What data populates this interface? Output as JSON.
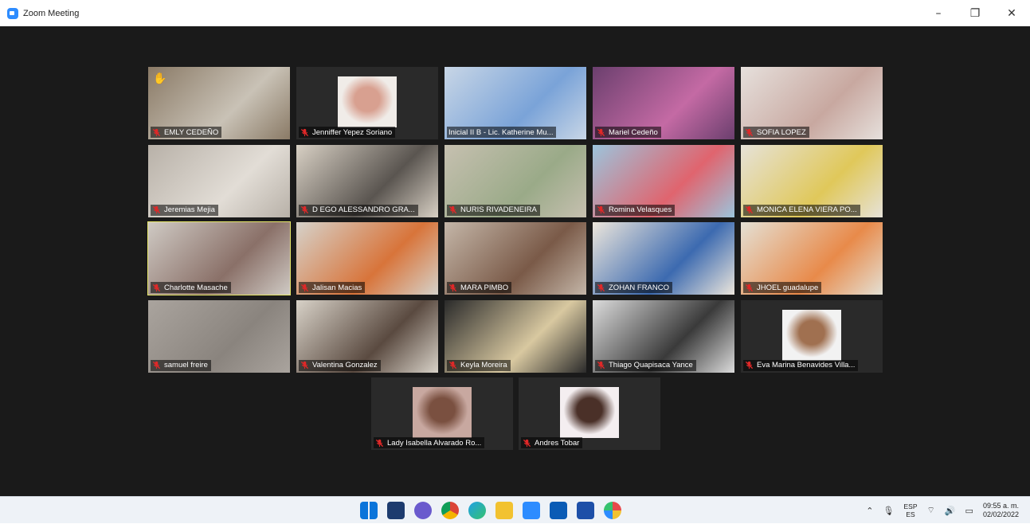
{
  "window": {
    "title": "Zoom Meeting",
    "minimize": "–",
    "restore": "❐",
    "close": "✕"
  },
  "participants": [
    {
      "name": "EMLY CEDEÑO",
      "muted": true,
      "hand_raised": true
    },
    {
      "name": "Jenniffer Yepez Soriano",
      "muted": true,
      "photo": true
    },
    {
      "name": "Inicial II B - Lic. Katherine Mu...",
      "muted": false
    },
    {
      "name": "Mariel Cedeño",
      "muted": true
    },
    {
      "name": "SOFIA LOPEZ",
      "muted": true
    },
    {
      "name": "Jeremias Mejia",
      "muted": true
    },
    {
      "name": "D EGO ALESSANDRO GRA...",
      "muted": true
    },
    {
      "name": "NURIS RIVADENEIRA",
      "muted": true
    },
    {
      "name": "Romina Velasques",
      "muted": true
    },
    {
      "name": "MONICA ELENA VIERA PO...",
      "muted": true
    },
    {
      "name": "Charlotte Masache",
      "muted": true,
      "active_speaker": true
    },
    {
      "name": "Jalisan Macias",
      "muted": true
    },
    {
      "name": "MARA PIMBO",
      "muted": true
    },
    {
      "name": "ZOHAN FRANCO",
      "muted": true
    },
    {
      "name": "JHOEL guadalupe",
      "muted": true
    },
    {
      "name": "samuel freire",
      "muted": true
    },
    {
      "name": "Valentina Gonzalez",
      "muted": true
    },
    {
      "name": "Keyla Moreira",
      "muted": true
    },
    {
      "name": "Thiago Quapisaca Yance",
      "muted": true
    },
    {
      "name": "Eva Marina Benavides Villa...",
      "muted": true,
      "photo": true
    },
    {
      "name": "Lady Isabella Alvarado Ro...",
      "muted": true,
      "photo": true
    },
    {
      "name": "Andres Tobar",
      "muted": true,
      "photo": true
    }
  ],
  "taskbar": {
    "apps": [
      "windows-start-icon",
      "task-view-icon",
      "chat-icon",
      "chrome-icon",
      "edge-icon",
      "file-explorer-icon",
      "zoom-icon",
      "mail-icon",
      "store-icon",
      "paint-icon"
    ],
    "language_top": "ESP",
    "language_bottom": "ES",
    "time": "09:55 a. m.",
    "date": "02/02/2022"
  },
  "colors": {
    "meeting_bg": "#1a1a1a",
    "active_border": "#e8e86a",
    "mute_red": "#e02828",
    "zoom_blue": "#2d8cff"
  }
}
